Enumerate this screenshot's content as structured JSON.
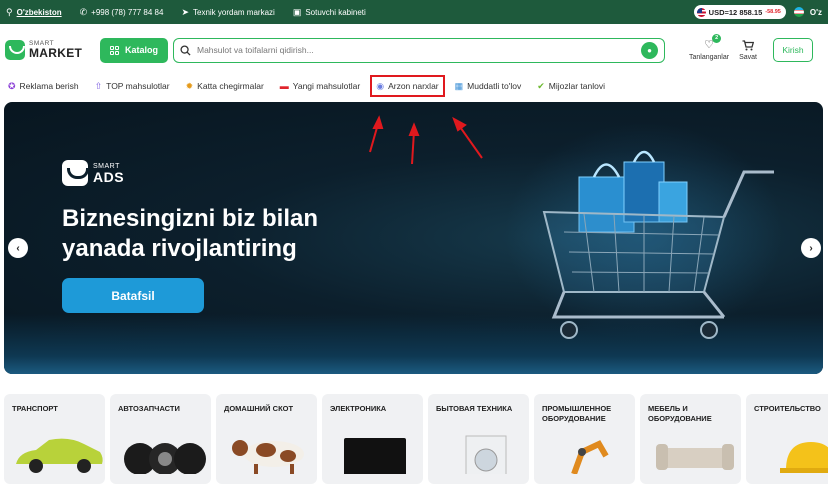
{
  "topbar": {
    "region": "O'zbekiston",
    "phone": "+998 (78) 777 84 84",
    "support": "Texnik yordam markazi",
    "seller": "Sotuvchi kabineti",
    "usd_label": "USD=12 858.15",
    "usd_delta": "-58.95",
    "language": "O'z"
  },
  "header": {
    "logo_small": "SMART",
    "logo_big": "MARKET",
    "catalog_label": "Katalog",
    "search_placeholder": "Mahsulot va toifalarni qidirish...",
    "favorites_label": "Tanlanganlar",
    "favorites_count": "2",
    "cart_label": "Savat",
    "login_label": "Kirish"
  },
  "nav": {
    "items": [
      {
        "label": "Reklama berish",
        "icon": "megaphone-icon"
      },
      {
        "label": "TOP mahsulotlar",
        "icon": "top-arrow-icon"
      },
      {
        "label": "Katta chegirmalar",
        "icon": "discount-icon"
      },
      {
        "label": "Yangi mahsulotlar",
        "icon": "new-icon"
      },
      {
        "label": "Arzon narxlar",
        "icon": "coin-icon"
      },
      {
        "label": "Muddatli to'lov",
        "icon": "calendar-icon"
      },
      {
        "label": "Mijozlar tanlovi",
        "icon": "thumbs-up-icon"
      }
    ],
    "highlighted": "Arzon narxlar"
  },
  "banner": {
    "ads_small": "SMART",
    "ads_big": "ADS",
    "title_line1": "Biznesingizni biz bilan",
    "title_line2": "yanada rivojlantiring",
    "button_label": "Batafsil"
  },
  "categories": [
    {
      "label": "ТРАНСПОРТ"
    },
    {
      "label": "АВТОЗАПЧАСТИ"
    },
    {
      "label": "ДОМАШНИЙ СКОТ"
    },
    {
      "label": "ЭЛЕКТРОНИКА"
    },
    {
      "label": "БЫТОВАЯ ТЕХНИКА"
    },
    {
      "label": "ПРОМЫШЛЕННОЕ ОБОРУДОВАНИЕ"
    },
    {
      "label": "МЕБЕЛЬ И ОБОРУДОВАНИЕ"
    },
    {
      "label": "СТРОИТЕЛЬСТВО"
    }
  ],
  "colors": {
    "brand_green": "#2eb85c",
    "topbar_green": "#1e5a3c",
    "highlight_red": "#e0191e",
    "button_blue": "#1e9ad8"
  }
}
